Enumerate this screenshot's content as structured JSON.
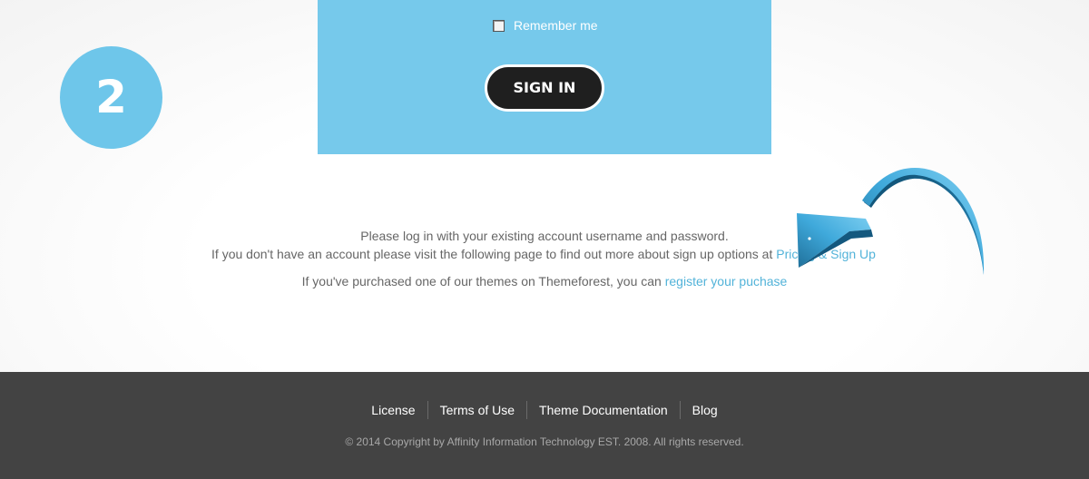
{
  "step": {
    "number": "2"
  },
  "login": {
    "remember_label": "Remember me",
    "sign_in_label": "SIGN IN",
    "remember_checked": false
  },
  "info": {
    "line1": "Please log in with your existing account username and password.",
    "line2_prefix": "If you don't have an account please visit the following page to find out more about sign up options at ",
    "line2_link": "Pricing & Sign Up",
    "line3_prefix": "If you've purchased one of our themes on Themeforest, you can ",
    "line3_link": "register your puchase"
  },
  "footer": {
    "links": [
      "License",
      "Terms of Use",
      "Theme Documentation",
      "Blog"
    ],
    "copyright": "© 2014 Copyright by Affinity Information Technology EST. 2008. All rights reserved."
  },
  "colors": {
    "accent_blue": "#76c9eb",
    "badge_blue": "#6ec6ea",
    "link_blue": "#52b3d9",
    "button_dark": "#1f1f1f",
    "footer_bg": "#434343"
  },
  "icons": {
    "arrow": "curved-arrow-icon"
  }
}
